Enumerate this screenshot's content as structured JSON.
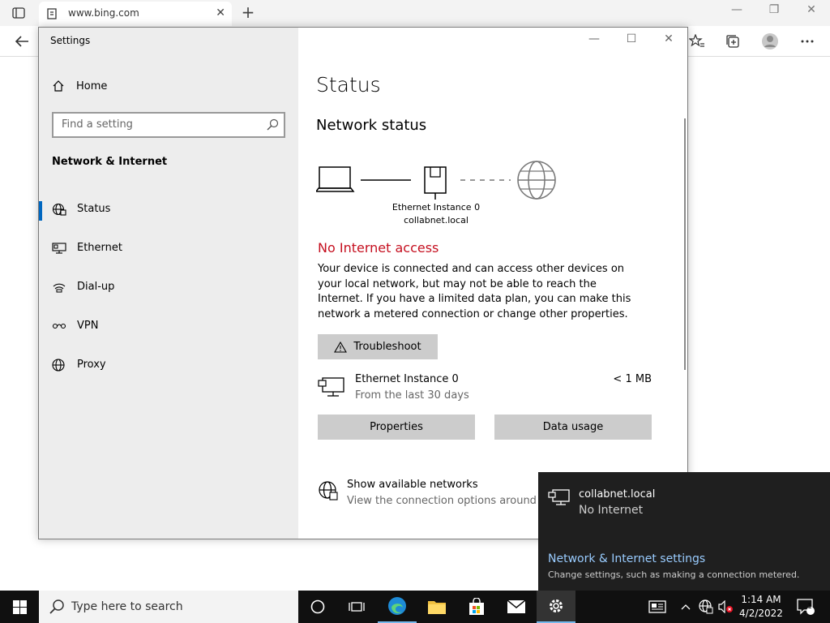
{
  "browser": {
    "tab_title": "www.bing.com",
    "tab_close": "✕",
    "new_tab": "+",
    "minimize": "—",
    "restore": "❐",
    "close": "✕"
  },
  "settings": {
    "window_title": "Settings",
    "home": "Home",
    "search_placeholder": "Find a setting",
    "section": "Network & Internet",
    "nav": [
      {
        "label": "Status"
      },
      {
        "label": "Ethernet"
      },
      {
        "label": "Dial-up"
      },
      {
        "label": "VPN"
      },
      {
        "label": "Proxy"
      }
    ],
    "minimize": "—",
    "maximize": "☐",
    "close": "✕",
    "content": {
      "title": "Status",
      "network_status": "Network status",
      "adapter_name": "Ethernet Instance 0",
      "adapter_domain": "collabnet.local",
      "no_internet": "No Internet access",
      "description": "Your device is connected and can access other devices on your local network, but may not be able to reach the Internet. If you have a limited data plan, you can make this network a metered connection or change other properties.",
      "troubleshoot": "Troubleshoot",
      "adapter_row_name": "Ethernet Instance 0",
      "adapter_row_sub": "From the last 30 days",
      "adapter_row_size": "< 1 MB",
      "properties": "Properties",
      "data_usage": "Data usage",
      "show_networks": "Show available networks",
      "show_networks_sub": "View the connection options around you."
    }
  },
  "flyout": {
    "network_name": "collabnet.local",
    "network_status": "No Internet",
    "settings_link": "Network & Internet settings",
    "settings_sub": "Change settings, such as making a connection metered."
  },
  "taskbar": {
    "search_placeholder": "Type here to search",
    "time": "1:14 AM",
    "date": "4/2/2022",
    "notification_count": "1"
  },
  "colors": {
    "accent": "#0067c0",
    "error": "#c50f1f",
    "link": "#99ccff"
  }
}
